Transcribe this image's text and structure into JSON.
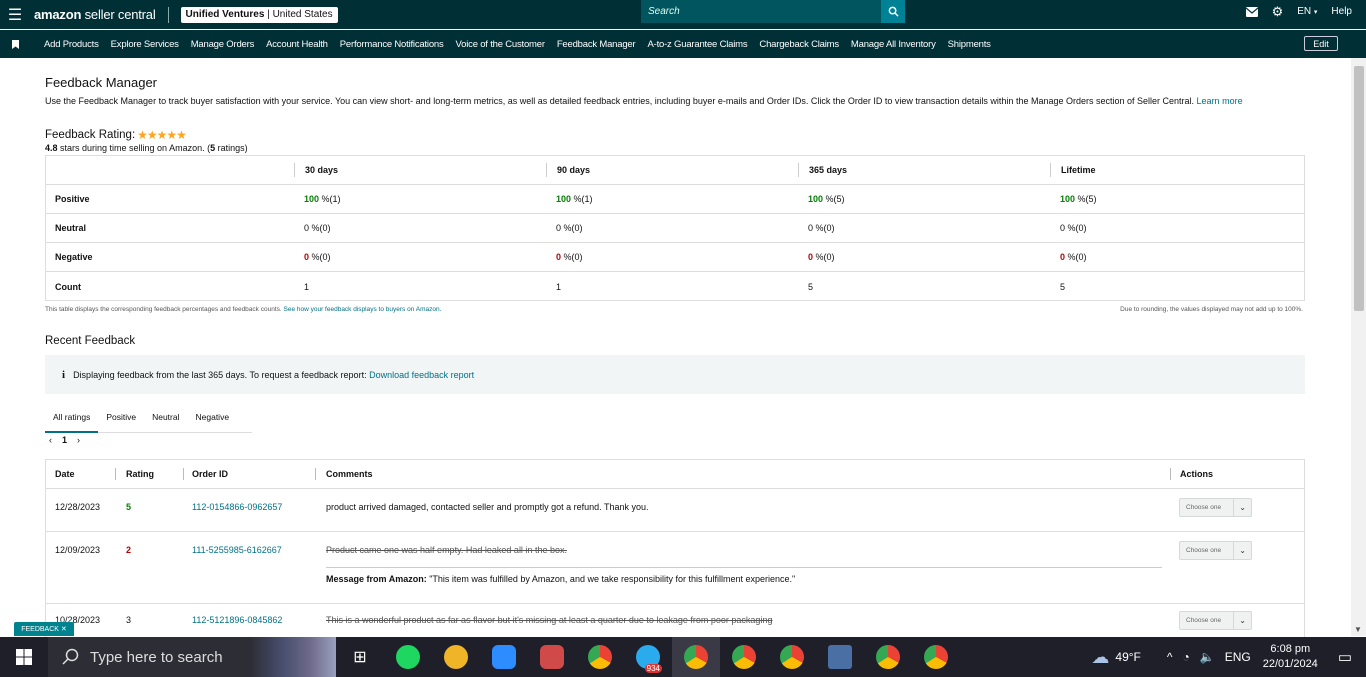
{
  "header": {
    "brand_main": "amazon",
    "brand_rest": " seller central",
    "account_name": "Unified Ventures",
    "account_sep": " | ",
    "account_region": "United States",
    "search_placeholder": "Search",
    "language": "EN",
    "help": "Help"
  },
  "nav": {
    "items": [
      "Add Products",
      "Explore Services",
      "Manage Orders",
      "Account Health",
      "Performance Notifications",
      "Voice of the Customer",
      "Feedback Manager",
      "A-to-z Guarantee Claims",
      "Chargeback Claims",
      "Manage All Inventory",
      "Shipments"
    ],
    "edit": "Edit"
  },
  "page": {
    "title": "Feedback Manager",
    "description": "Use the Feedback Manager to track buyer satisfaction with your service. You can view short- and long-term metrics, as well as detailed feedback entries, including buyer e-mails and Order IDs. Click the Order ID to view transaction details within the Manage Orders section of Seller Central.",
    "learn_more": "Learn more",
    "rating_label": "Feedback Rating:",
    "stars": "★★★★★",
    "rating_value": "4.8",
    "rating_text_1": " stars during time selling on Amazon. (",
    "rating_count": "5",
    "rating_text_2": " ratings)"
  },
  "summary": {
    "columns": [
      "30 days",
      "90 days",
      "365 days",
      "Lifetime"
    ],
    "rows": [
      {
        "label": "Positive",
        "cells": [
          {
            "v": "100",
            "r": " %(1)"
          },
          {
            "v": "100",
            "r": " %(1)"
          },
          {
            "v": "100",
            "r": " %(5)"
          },
          {
            "v": "100",
            "r": " %(5)"
          }
        ]
      },
      {
        "label": "Neutral",
        "cells": [
          {
            "v": "0",
            "r": " %(0)"
          },
          {
            "v": "0",
            "r": " %(0)"
          },
          {
            "v": "0",
            "r": " %(0)"
          },
          {
            "v": "0",
            "r": " %(0)"
          }
        ]
      },
      {
        "label": "Negative",
        "cells": [
          {
            "v": "0",
            "r": " %(0)"
          },
          {
            "v": "0",
            "r": " %(0)"
          },
          {
            "v": "0",
            "r": " %(0)"
          },
          {
            "v": "0",
            "r": " %(0)"
          }
        ]
      },
      {
        "label": "Count",
        "cells": [
          {
            "v": "",
            "r": "1"
          },
          {
            "v": "",
            "r": "1"
          },
          {
            "v": "",
            "r": "5"
          },
          {
            "v": "",
            "r": "5"
          }
        ]
      }
    ],
    "note_left": "This table displays the corresponding feedback percentages and feedback counts.",
    "note_link": "See how your feedback displays to buyers on Amazon.",
    "note_right": "Due to rounding, the values displayed may not add up to 100%."
  },
  "recent": {
    "title": "Recent Feedback",
    "info_icon": "i",
    "info_text": "Displaying feedback from the last 365 days. To request a feedback report:",
    "info_link": "Download feedback report",
    "tabs": [
      "All ratings",
      "Positive",
      "Neutral",
      "Negative"
    ],
    "pager_prev": "‹",
    "pager_page": "1",
    "pager_next": "›",
    "headers": {
      "date": "Date",
      "rating": "Rating",
      "order": "Order ID",
      "comments": "Comments",
      "actions": "Actions"
    },
    "rows": [
      {
        "date": "12/28/2023",
        "rating": "5",
        "order": "112-0154866-0962657",
        "comment": "product arrived damaged, contacted seller and promptly got a refund. Thank you.",
        "action": "Choose one"
      },
      {
        "date": "12/09/2023",
        "rating": "2",
        "order": "111-5255985-6162667",
        "comment": "Product came one was half empty. Had leaked all in the box.",
        "msg_label": "Message from Amazon:",
        "msg_text": " \"This item was fulfilled by Amazon, and we take responsibility for this fulfillment experience.\"",
        "action": "Choose one"
      },
      {
        "date": "10/28/2023",
        "rating": "3",
        "order": "112-5121896-0845862",
        "comment": "This is a wonderful product as far as flavor but it's missing at least a quarter due to leakage from poor packaging",
        "action": "Choose one"
      }
    ]
  },
  "feedback_tab": "FEEDBACK ✕",
  "taskbar": {
    "search_placeholder": "Type here to search",
    "telegram_badge": "934",
    "weather": "49°F",
    "lang": "ENG",
    "time": "6:08 pm",
    "date": "22/01/2024"
  },
  "colors": {
    "header_bg": "#002f36",
    "link": "#007185",
    "positive": "#067d06",
    "negative": "#b00000"
  }
}
